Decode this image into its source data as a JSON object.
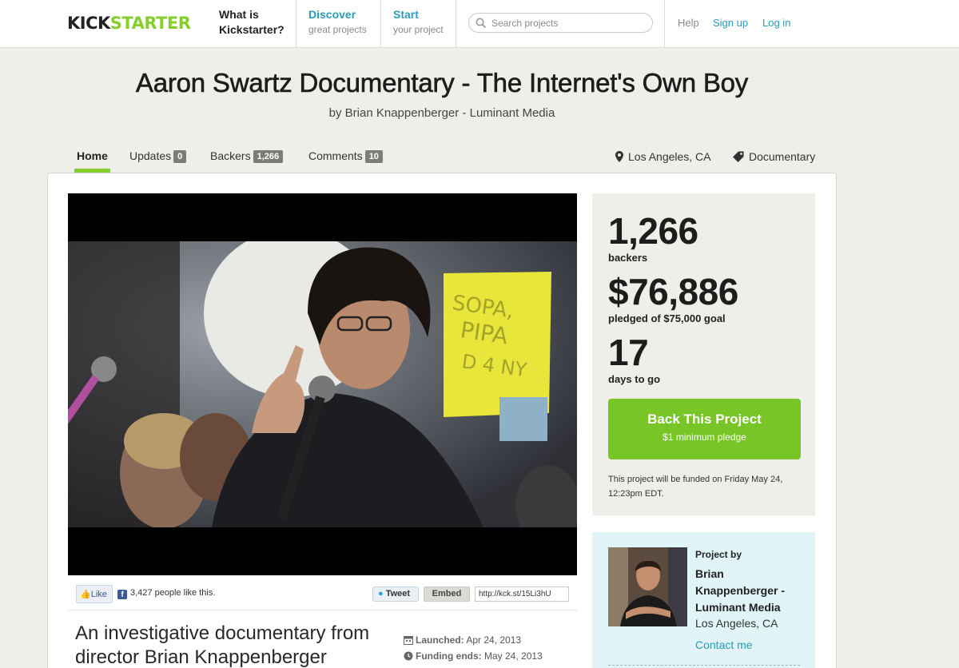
{
  "header": {
    "logo_part1": "KICK",
    "logo_part2": "STARTER",
    "nav": [
      {
        "title": "What is",
        "title2": "Kickstarter?"
      },
      {
        "title": "Discover",
        "sub": "great projects"
      },
      {
        "title": "Start",
        "sub": "your project"
      }
    ],
    "search_placeholder": "Search projects",
    "help": "Help",
    "signup": "Sign up",
    "login": "Log in"
  },
  "project": {
    "title": "Aaron Swartz Documentary - The Internet's Own Boy",
    "byline": "by Brian Knappenberger - Luminant Media",
    "location": "Los Angeles, CA",
    "category": "Documentary",
    "blurb": "An investigative documentary from director Brian Knappenberger"
  },
  "tabs": [
    {
      "label": "Home"
    },
    {
      "label": "Updates",
      "count": "0"
    },
    {
      "label": "Backers",
      "count": "1,266"
    },
    {
      "label": "Comments",
      "count": "10"
    }
  ],
  "video": {
    "sign_text": "SOPA, PIPA, ... 4 NY"
  },
  "share": {
    "like_label": "Like",
    "like_count_text": "3,427 people like this.",
    "tweet_label": "Tweet",
    "embed_label": "Embed",
    "short_url": "http://kck.st/15Li3hU"
  },
  "dates": {
    "launched_label": "Launched:",
    "launched_value": "Apr 24, 2013",
    "ends_label": "Funding ends:",
    "ends_value": "May 24, 2013"
  },
  "stats": {
    "backers": "1,266",
    "backers_label": "backers",
    "pledged": "$76,886",
    "pledged_label": "pledged of $75,000 goal",
    "days": "17",
    "days_label": "days to go",
    "back_button": "Back This Project",
    "back_sub": "$1 minimum pledge",
    "fund_note": "This project will be funded on Friday May 24, 12:23pm EDT."
  },
  "creator": {
    "project_by": "Project by",
    "name": "Brian Knappenberger - Luminant Media",
    "location": "Los Angeles, CA",
    "contact": "Contact me"
  },
  "colors": {
    "brand_green": "#86ce2e",
    "link_blue": "#2a9bb8",
    "button_green": "#78c527"
  }
}
